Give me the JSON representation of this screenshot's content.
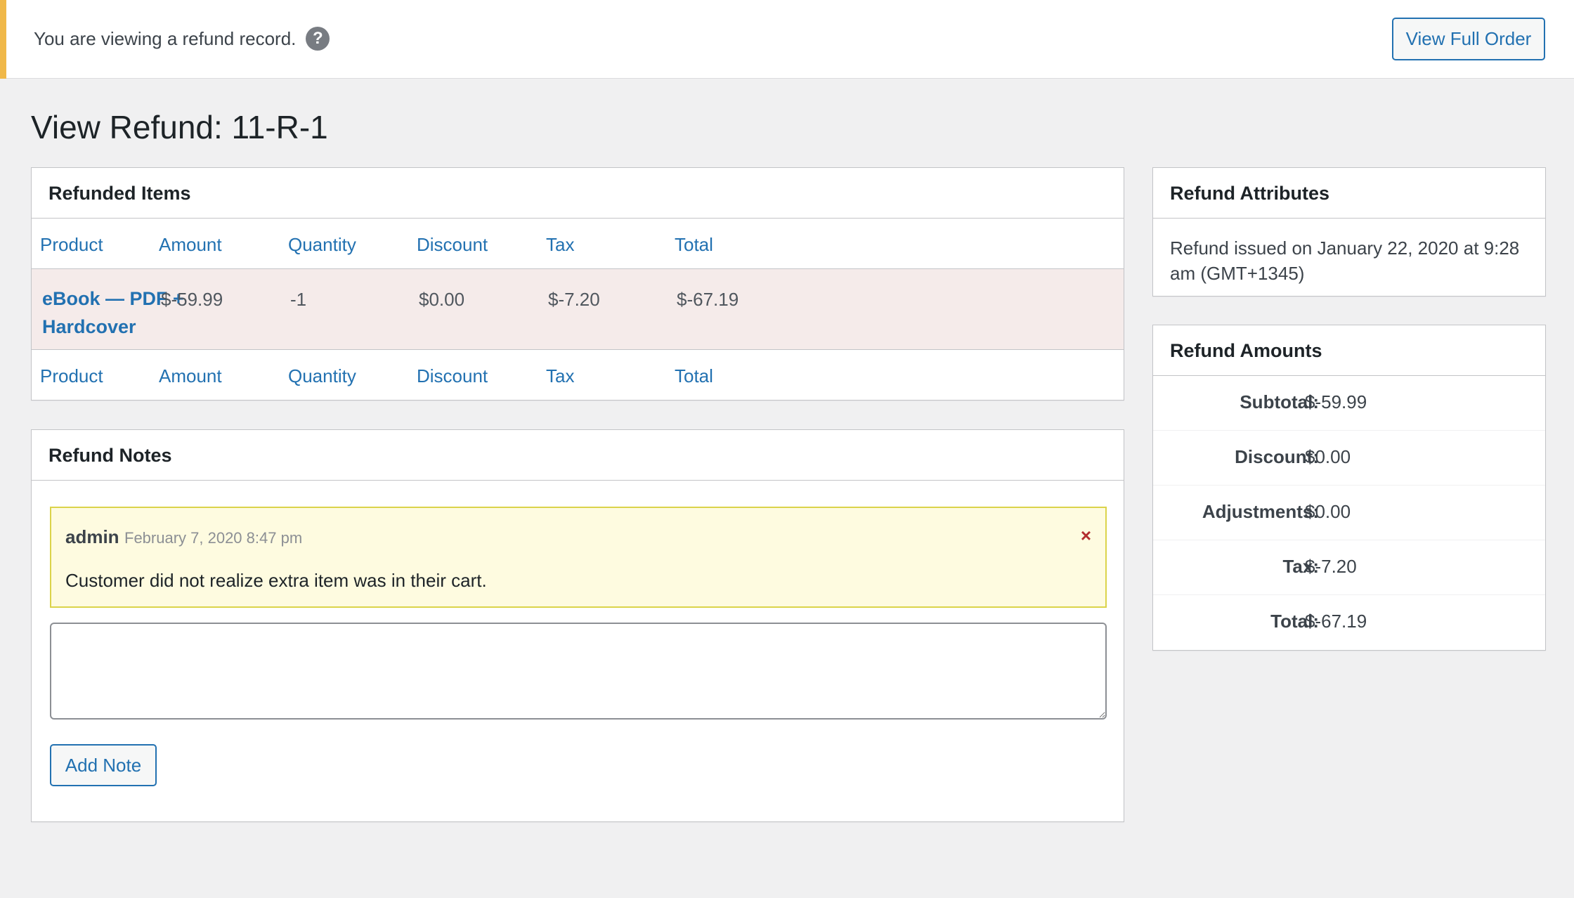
{
  "notice": {
    "message": "You are viewing a refund record.",
    "help_icon": "question-mark-icon",
    "view_full_order_label": "View Full Order",
    "accent_color": "#f0b849"
  },
  "page": {
    "title": "View Refund: 11-R-1"
  },
  "refunded_items": {
    "title": "Refunded Items",
    "columns": [
      "Product",
      "Amount",
      "Quantity",
      "Discount",
      "Tax",
      "Total"
    ],
    "rows": [
      {
        "product": "eBook — PDF + Hardcover",
        "amount": "$-59.99",
        "quantity": "-1",
        "discount": "$0.00",
        "tax": "$-7.20",
        "total": "$-67.19"
      }
    ],
    "row_background": "#f5ebea"
  },
  "refund_notes": {
    "title": "Refund Notes",
    "notes": [
      {
        "author": "admin",
        "date": "February 7, 2020 8:47 pm",
        "text": "Customer did not realize extra item was in their cart.",
        "delete_symbol": "×"
      }
    ],
    "input_value": "",
    "add_note_label": "Add Note"
  },
  "refund_attributes": {
    "title": "Refund Attributes",
    "issued_text": "Refund issued on January 22, 2020 at 9:28 am (GMT+1345)"
  },
  "refund_amounts": {
    "title": "Refund Amounts",
    "rows": [
      {
        "label": "Subtotal:",
        "value": "$-59.99"
      },
      {
        "label": "Discount:",
        "value": "$0.00"
      },
      {
        "label": "Adjustments:",
        "value": "$0.00"
      },
      {
        "label": "Tax:",
        "value": "$-7.20"
      },
      {
        "label": "Total:",
        "value": "$-67.19"
      }
    ]
  },
  "colors": {
    "link": "#2271b1",
    "note_background": "#fefbe0",
    "note_border": "#dbd34a",
    "delete": "#b32d2e"
  }
}
